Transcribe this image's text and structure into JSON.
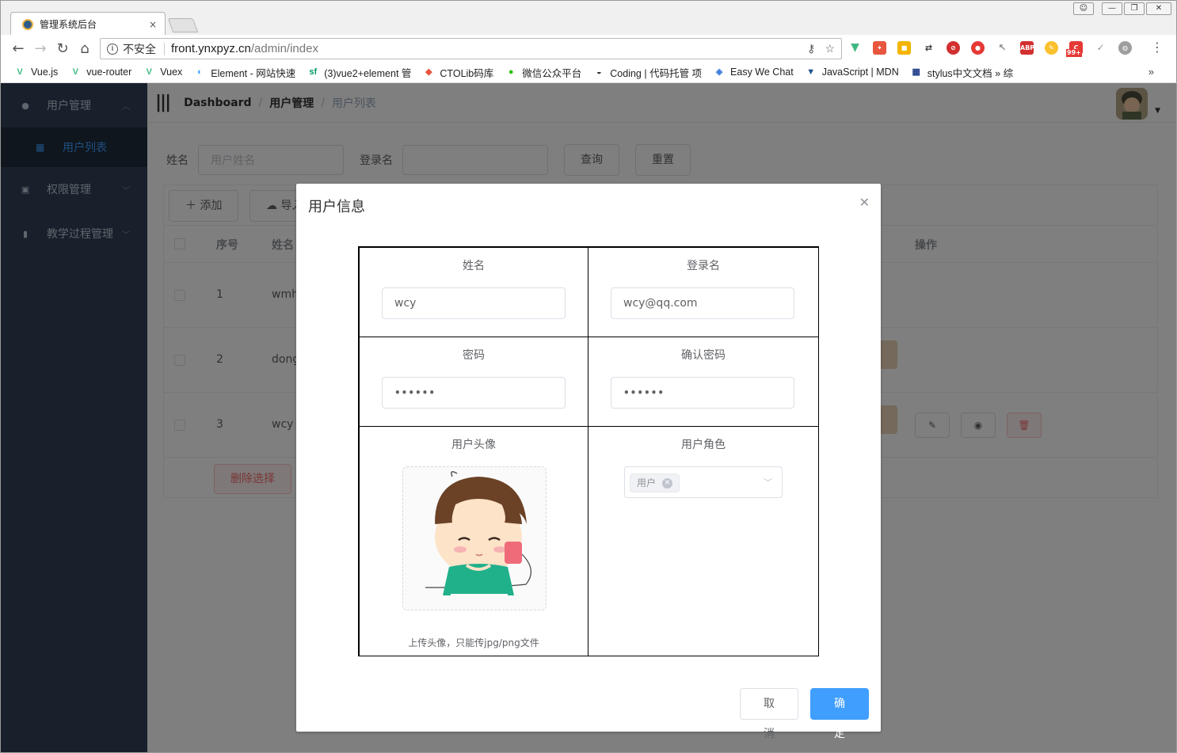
{
  "browser": {
    "tab_title": "管理系统后台",
    "tab_close": "×",
    "insecure_label": "不安全",
    "url_host": "front.ynxpyz.cn",
    "url_path": "/admin/index",
    "bookmarks": [
      {
        "label": "Vue.js",
        "icon": "vue-icon",
        "color": "#41b883",
        "glyph": "V"
      },
      {
        "label": "vue-router",
        "icon": "vue-icon",
        "color": "#41b883",
        "glyph": "V"
      },
      {
        "label": "Vuex",
        "icon": "vue-icon",
        "color": "#41b883",
        "glyph": "V"
      },
      {
        "label": "Element - 网站快速",
        "icon": "element-icon",
        "color": "#409eff",
        "glyph": "◐"
      },
      {
        "label": "(3)vue2+element 管",
        "icon": "sf-icon",
        "color": "#009a61",
        "glyph": "sf"
      },
      {
        "label": "CTOLib码库",
        "icon": "ctolib-icon",
        "color": "#e8563f",
        "glyph": "◆"
      },
      {
        "label": "微信公众平台",
        "icon": "wechat-icon",
        "color": "#2dc100",
        "glyph": "●"
      },
      {
        "label": "Coding | 代码托管 项",
        "icon": "coding-icon",
        "color": "#333333",
        "glyph": "◒"
      },
      {
        "label": "Easy We Chat",
        "icon": "easy-wechat-icon",
        "color": "#3b7ddd",
        "glyph": "◈"
      },
      {
        "label": "JavaScript | MDN",
        "icon": "mdn-icon",
        "color": "#1d4f91",
        "glyph": "▼"
      },
      {
        "label": "stylus中文文档 » 综",
        "icon": "stylus-icon",
        "color": "#1f3c88",
        "glyph": "▦"
      }
    ],
    "bookmarks_more": "»",
    "extension_badge": "99+"
  },
  "sidebar": {
    "items": [
      {
        "label": "用户管理",
        "icon": "user-icon",
        "expanded": true
      },
      {
        "label": "权限管理",
        "icon": "lock-icon",
        "expanded": false
      },
      {
        "label": "教学过程管理",
        "icon": "chart-icon",
        "expanded": false
      }
    ],
    "sub_items": [
      {
        "label": "用户列表",
        "icon": "grid-icon",
        "active": true
      }
    ]
  },
  "breadcrumb": [
    "Dashboard",
    "用户管理",
    "用户列表"
  ],
  "search": {
    "name_label": "姓名",
    "name_placeholder": "用户姓名",
    "login_label": "登录名",
    "query_button": "查询",
    "reset_button": "重置"
  },
  "table": {
    "add_button": "添加",
    "import_button": "导入",
    "headers": {
      "index": "序号",
      "name": "姓名",
      "actions": "操作"
    },
    "rows": [
      {
        "index": "1",
        "name": "wmhe"
      },
      {
        "index": "2",
        "name": "dong"
      },
      {
        "index": "3",
        "name": "wcy"
      }
    ],
    "delete_selected": "删除选择"
  },
  "dialog": {
    "title": "用户信息",
    "name_label": "姓名",
    "name_value": "wcy",
    "login_label": "登录名",
    "login_value": "wcy@qq.com",
    "password_label": "密码",
    "password_value": "••••••",
    "confirm_label": "确认密码",
    "confirm_value": "••••••",
    "avatar_label": "用户头像",
    "avatar_tip": "上传头像，只能传jpg/png文件",
    "role_label": "用户角色",
    "role_tag": "用户",
    "cancel_button": "取 消",
    "ok_button": "确 定"
  },
  "colors": {
    "sidebar_bg": "#304156",
    "accent": "#409eff",
    "danger": "#f56c6c"
  }
}
